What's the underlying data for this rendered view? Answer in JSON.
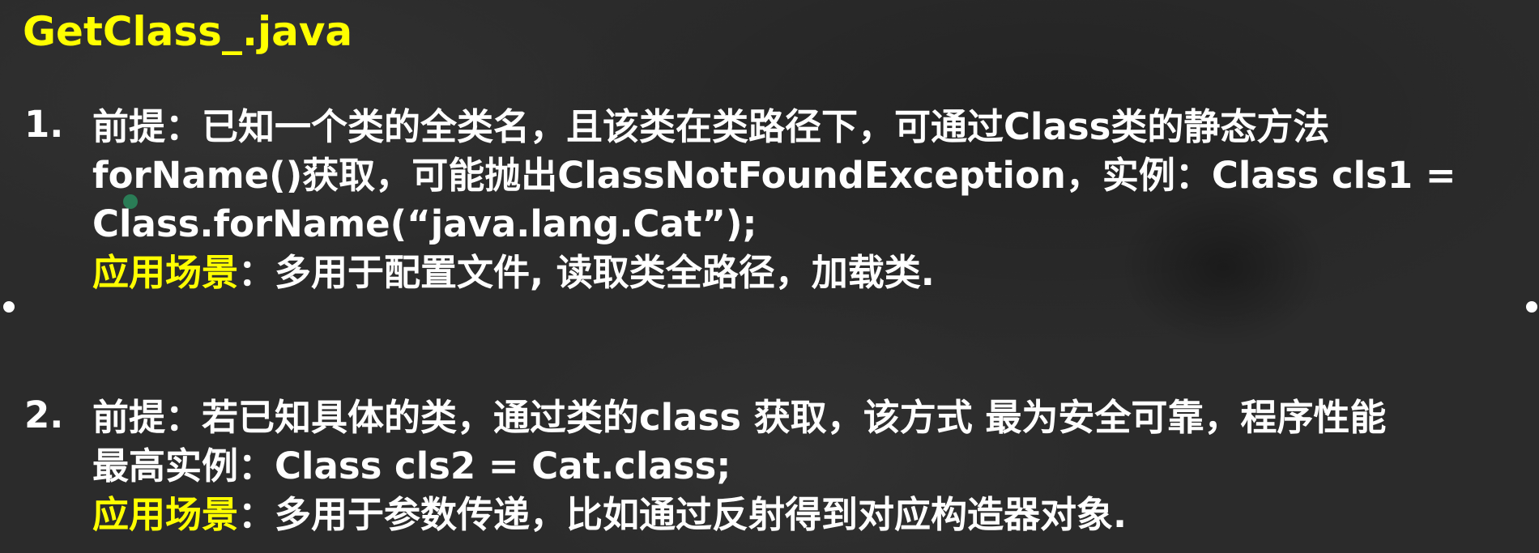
{
  "slide": {
    "title": "GetClass_.java",
    "items": [
      {
        "number": "1.",
        "lines": [
          "前提：已知一个类的全类名，且该类在类路径下，可通过Class类的静态方法",
          "forName()获取，可能抛出ClassNotFoundException，实例：Class cls1 =",
          "Class.forName(“java.lang.Cat”);"
        ],
        "scene_label": "应用场景",
        "scene_colon": "：",
        "scene_text": "多用于配置文件, 读取类全路径，加载类."
      },
      {
        "number": "2.",
        "lines": [
          "前提：若已知具体的类，通过类的class 获取，该方式 最为安全可靠，程序性能",
          "最高实例：Class cls2 = Cat.class;"
        ],
        "scene_label": "应用场景",
        "scene_colon": "：",
        "scene_text": "多用于参数传递，比如通过反射得到对应构造器对象."
      }
    ]
  },
  "colors": {
    "background": "#2b2b2b",
    "title": "#ffff00",
    "text": "#ffffff",
    "highlight": "#ffff00"
  }
}
